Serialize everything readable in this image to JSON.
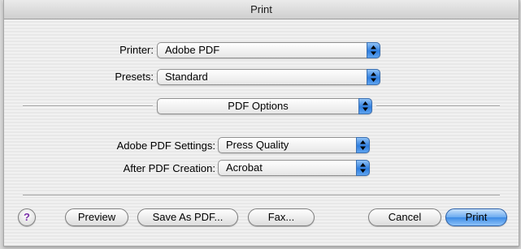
{
  "window": {
    "title": "Print"
  },
  "printer": {
    "label": "Printer:",
    "value": "Adobe PDF"
  },
  "presets": {
    "label": "Presets:",
    "value": "Standard"
  },
  "pane": {
    "value": "PDF Options"
  },
  "pdf_settings": {
    "label": "Adobe PDF Settings:",
    "value": "Press Quality"
  },
  "after_creation": {
    "label": "After PDF Creation:",
    "value": "Acrobat"
  },
  "buttons": {
    "help": "?",
    "preview": "Preview",
    "save_as_pdf": "Save As PDF...",
    "fax": "Fax...",
    "cancel": "Cancel",
    "print": "Print"
  },
  "colors": {
    "accent": "#3d8be6",
    "help_glyph": "#7a2fa8"
  },
  "icons": {
    "popup_arrow": "up-down-arrows-icon"
  }
}
